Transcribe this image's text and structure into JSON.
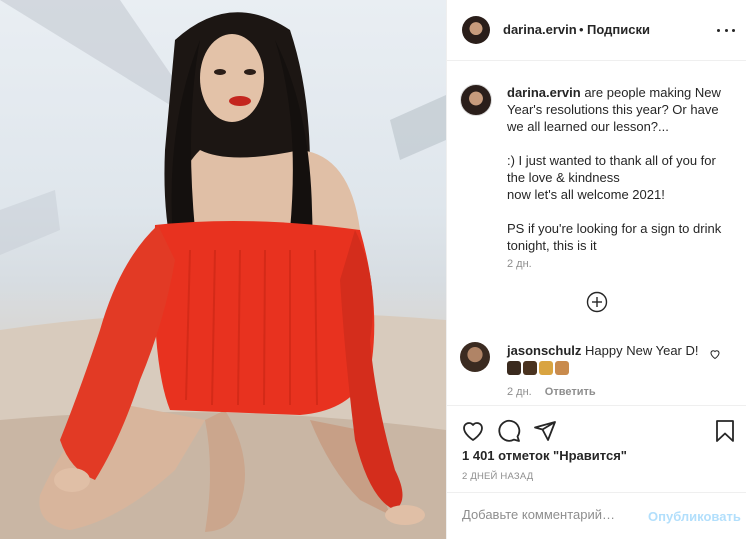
{
  "post": {
    "username": "darina.ervin",
    "dot": "•",
    "follow_label": "Подписки",
    "more_icon": "more-horizontal-icon",
    "caption": {
      "username": "darina.ervin",
      "line1": "are people making New Year's resolutions this year? Or have we all learned our lesson?...",
      "line2": ":) I just wanted to thank all of you for the love & kindness",
      "line3": "now let's all welcome 2021!",
      "line4": "PS if you're looking for a sign to drink tonight, this is it",
      "time": "2 дн."
    },
    "load_more_icon": "plus-circle-icon",
    "comment": {
      "username": "jasonschulz",
      "text": "Happy New Year D!",
      "time": "2 дн.",
      "reply_label": "Ответить",
      "like_icon": "heart-icon"
    },
    "actions": {
      "like_icon": "heart-icon",
      "comment_icon": "comment-icon",
      "share_icon": "send-icon",
      "save_icon": "bookmark-icon"
    },
    "likes": "1 401 отметок \"Нравится\"",
    "date": "2 ДНЕЙ НАЗАД",
    "add_comment_placeholder": "Добавьте комментарий…",
    "publish_label": "Опубликовать",
    "colors": {
      "publish": "#b2dffc",
      "sweater": "#e8321f",
      "muted": "#8e8e8e"
    }
  }
}
